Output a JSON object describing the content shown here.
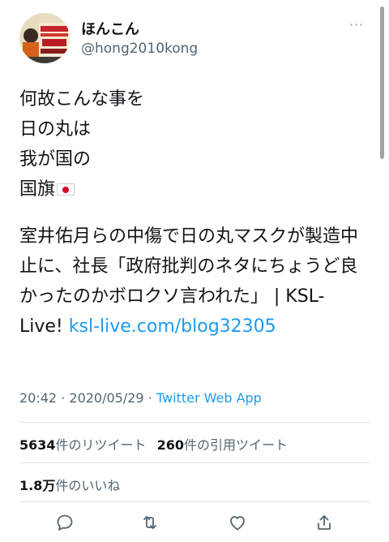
{
  "user": {
    "display_name": "ほんこん",
    "handle": "@hong2010kong"
  },
  "tweet": {
    "lines": [
      "何故こんな事を",
      "日の丸は",
      "我が国の",
      "国旗"
    ],
    "flag_emoji": "japan-flag-icon",
    "paragraph2": "室井佑月らの中傷で日の丸マスクが製造中止に、社長「政府批判のネタにちょうど良かったのかボロクソ言われた」 | KSL-Live! ",
    "link_text": "ksl-live.com/blog32305"
  },
  "meta": {
    "time": "20:42",
    "separator": "·",
    "date": "2020/05/29",
    "app": "Twitter Web App"
  },
  "stats": {
    "retweets_count": "5634",
    "retweets_label": "件のリツイート",
    "quotes_count": "260",
    "quotes_label": "件の引用ツイート",
    "likes_count": "1.8万",
    "likes_label": "件のいいね"
  },
  "colors": {
    "link": "#1d9bf0",
    "secondary_text": "#536471",
    "primary_text": "#0f1419",
    "flag_red": "#d60a2b"
  },
  "actions": [
    "reply-icon",
    "retweet-icon",
    "like-icon",
    "share-icon"
  ]
}
